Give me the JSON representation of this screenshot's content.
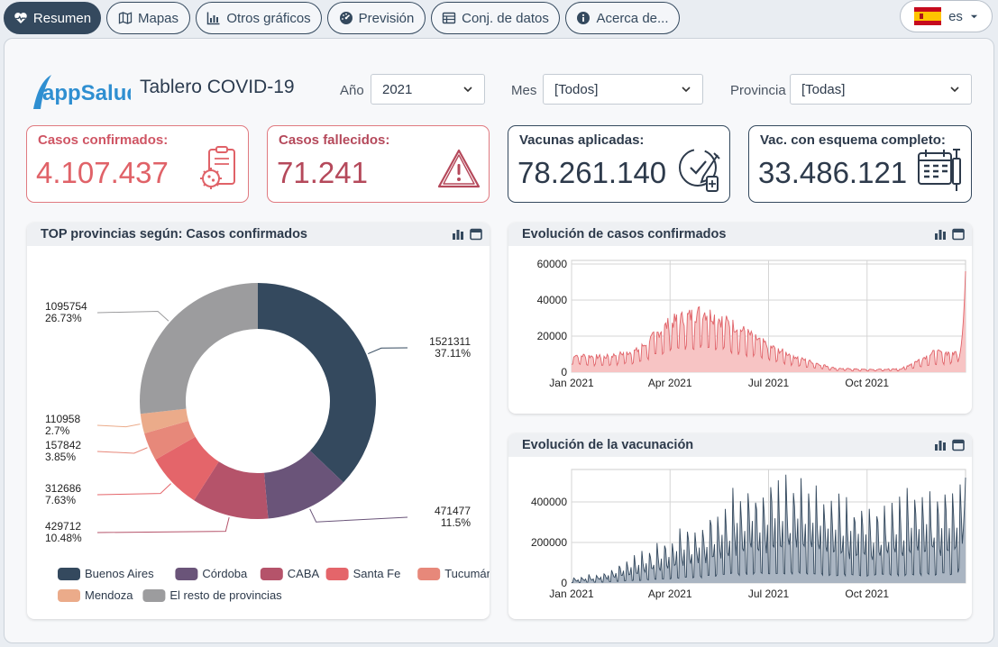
{
  "nav": {
    "tabs": [
      {
        "label": "Resumen",
        "icon": "heart-pulse-icon",
        "active": true
      },
      {
        "label": "Mapas",
        "icon": "map-icon",
        "active": false
      },
      {
        "label": "Otros gráficos",
        "icon": "bar-chart-icon",
        "active": false
      },
      {
        "label": "Previsión",
        "icon": "gauge-icon",
        "active": false
      },
      {
        "label": "Conj. de datos",
        "icon": "table-icon",
        "active": false
      },
      {
        "label": "Acerca de...",
        "icon": "info-icon",
        "active": false
      }
    ],
    "language": {
      "label": "es",
      "icon": "spain-flag-icon"
    }
  },
  "header": {
    "logo_text": "appSalud",
    "title": "Tablero COVID-19"
  },
  "filters": {
    "year": {
      "label": "Año",
      "value": "2021"
    },
    "month": {
      "label": "Mes",
      "value": "[Todos]"
    },
    "province": {
      "label": "Provincia",
      "value": "[Todas]"
    }
  },
  "kpis": [
    {
      "label": "Casos confirmados:",
      "value": "4.107.437",
      "icon": "virus-clipboard-icon",
      "accent": "#e06268"
    },
    {
      "label": "Casos fallecidos:",
      "value": "71.241",
      "icon": "warning-icon",
      "accent": "#b5495b"
    },
    {
      "label": "Vacunas aplicadas:",
      "value": "78.261.140",
      "icon": "syringe-vial-icon",
      "accent": "#2d3a4b"
    },
    {
      "label": "Vac. con esquema completo:",
      "value": "33.486.121",
      "icon": "calendar-syringe-icon",
      "accent": "#2d3a4b"
    }
  ],
  "donut_card": {
    "title": "TOP provincias según: Casos confirmados"
  },
  "cases_card": {
    "title": "Evolución de casos confirmados"
  },
  "vacc_card": {
    "title": "Evolución de la vacunación"
  },
  "chart_data": [
    {
      "type": "pie",
      "title": "TOP provincias según: Casos confirmados",
      "donut": true,
      "slices": [
        {
          "name": "Buenos Aires",
          "value": 1521311,
          "pct": "37.11%",
          "color": "#34495e"
        },
        {
          "name": "Córdoba",
          "value": 471477,
          "pct": "11.5%",
          "color": "#6a5479"
        },
        {
          "name": "CABA",
          "value": 429712,
          "pct": "10.48%",
          "color": "#b5536a"
        },
        {
          "name": "Santa Fe",
          "value": 312686,
          "pct": "7.63%",
          "color": "#e4656a"
        },
        {
          "name": "Tucumán",
          "value": 157842,
          "pct": "3.85%",
          "color": "#e7887a"
        },
        {
          "name": "Mendoza",
          "value": 110958,
          "pct": "2.7%",
          "color": "#ebab8a"
        },
        {
          "name": "El resto de provincias",
          "value": 1095754,
          "pct": "26.73%",
          "color": "#9c9c9e"
        }
      ],
      "legend_position": "bottom"
    },
    {
      "type": "area",
      "title": "Evolución de casos confirmados",
      "x_ticks": [
        "Jan 2021",
        "Apr 2021",
        "Jul 2021",
        "Oct 2021"
      ],
      "y_ticks": [
        0,
        20000,
        40000,
        60000
      ],
      "ylim": [
        0,
        62000
      ],
      "grid": true,
      "color": "#e06268",
      "fill": "#f7c4c4",
      "monthly_daily_avg": [
        {
          "month": "Jan 2021",
          "value": 8000
        },
        {
          "month": "Feb 2021",
          "value": 7000
        },
        {
          "month": "Mar 2021",
          "value": 10000
        },
        {
          "month": "Apr 2021",
          "value": 23000
        },
        {
          "month": "May 2021",
          "value": 28000
        },
        {
          "month": "Jun 2021",
          "value": 21000
        },
        {
          "month": "Jul 2021",
          "value": 12000
        },
        {
          "month": "Aug 2021",
          "value": 6000
        },
        {
          "month": "Sep 2021",
          "value": 1800
        },
        {
          "month": "Oct 2021",
          "value": 1200
        },
        {
          "month": "Nov 2021",
          "value": 1500
        },
        {
          "month": "Dec 2021",
          "value": 9000
        }
      ],
      "peak": {
        "date": "Dec 31 2021",
        "value": 56000
      }
    },
    {
      "type": "area",
      "title": "Evolución de la vacunación",
      "x_ticks": [
        "Jan 2021",
        "Apr 2021",
        "Jul 2021",
        "Oct 2021"
      ],
      "y_ticks": [
        0,
        200000,
        400000
      ],
      "ylim": [
        0,
        560000
      ],
      "grid": true,
      "color": "#34495e",
      "fill": "#aab5c2",
      "monthly_daily_avg": [
        {
          "month": "Jan 2021",
          "value": 15000
        },
        {
          "month": "Feb 2021",
          "value": 35000
        },
        {
          "month": "Mar 2021",
          "value": 90000
        },
        {
          "month": "Apr 2021",
          "value": 150000
        },
        {
          "month": "May 2021",
          "value": 210000
        },
        {
          "month": "Jun 2021",
          "value": 300000
        },
        {
          "month": "Jul 2021",
          "value": 330000
        },
        {
          "month": "Aug 2021",
          "value": 330000
        },
        {
          "month": "Sep 2021",
          "value": 280000
        },
        {
          "month": "Oct 2021",
          "value": 240000
        },
        {
          "month": "Nov 2021",
          "value": 280000
        },
        {
          "month": "Dec 2021",
          "value": 300000
        }
      ],
      "peak": {
        "date": "Dec 2021",
        "value": 520000
      }
    }
  ]
}
